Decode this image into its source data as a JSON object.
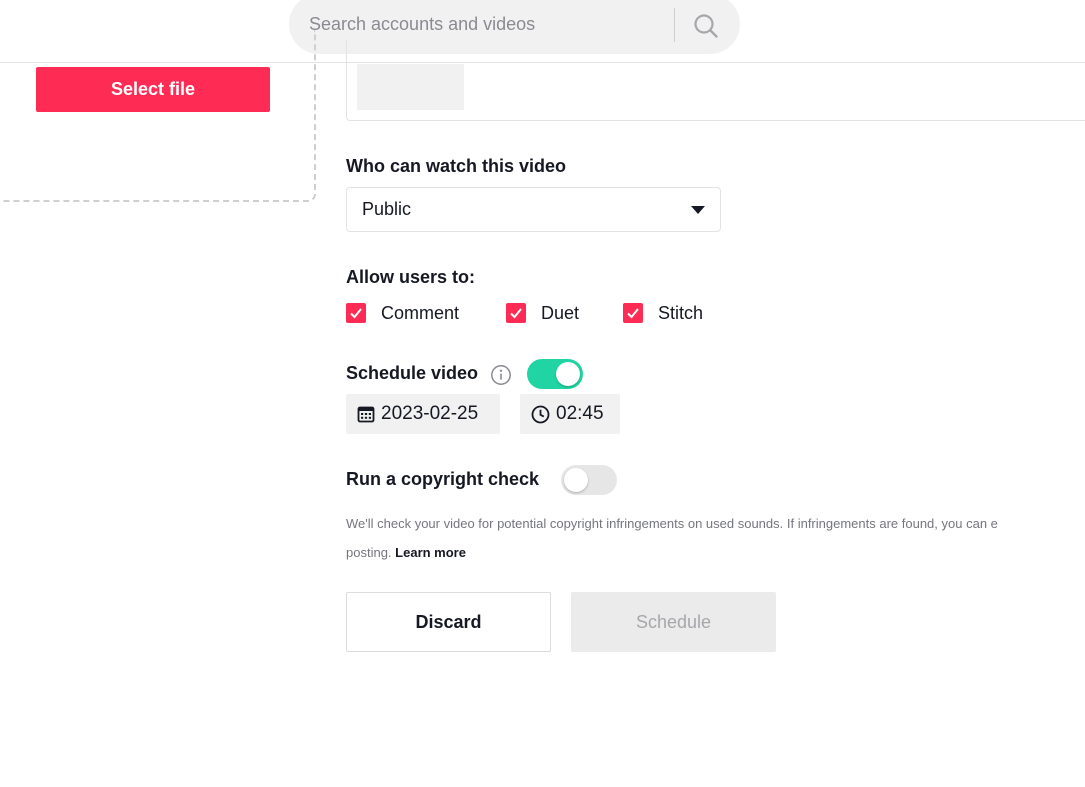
{
  "header": {
    "search_placeholder": "Search accounts and videos"
  },
  "upload": {
    "select_file_label": "Select file"
  },
  "privacy": {
    "label": "Who can watch this video",
    "selected": "Public"
  },
  "permissions": {
    "label": "Allow users to:",
    "items": [
      {
        "label": "Comment",
        "checked": true
      },
      {
        "label": "Duet",
        "checked": true
      },
      {
        "label": "Stitch",
        "checked": true
      }
    ]
  },
  "schedule": {
    "label": "Schedule video",
    "enabled": true,
    "date": "2023-02-25",
    "time": "02:45"
  },
  "copyright": {
    "label": "Run a copyright check",
    "enabled": false,
    "help_text": "We'll check your video for potential copyright infringements on used sounds. If infringements are found, you can e",
    "help_text_line2": "posting.",
    "learn_more": "Learn more"
  },
  "actions": {
    "discard_label": "Discard",
    "schedule_label": "Schedule"
  },
  "colors": {
    "accent": "#fe2c55",
    "toggle_on": "#20d5a3",
    "toggle_off": "#e6e6e7"
  }
}
